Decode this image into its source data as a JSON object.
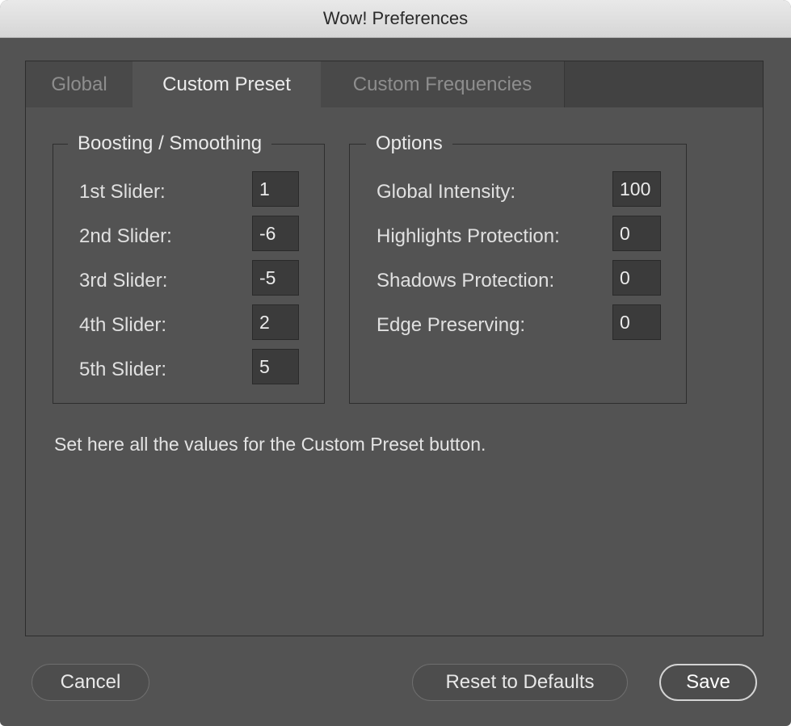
{
  "window": {
    "title": "Wow! Preferences"
  },
  "tabs": [
    {
      "label": "Global"
    },
    {
      "label": "Custom Preset"
    },
    {
      "label": "Custom Frequencies"
    }
  ],
  "active_tab": "Custom Preset",
  "boosting": {
    "legend": "Boosting / Smoothing",
    "rows": [
      {
        "label": "1st Slider:",
        "value": "1"
      },
      {
        "label": "2nd Slider:",
        "value": "-6"
      },
      {
        "label": "3rd Slider:",
        "value": "-5"
      },
      {
        "label": "4th Slider:",
        "value": "2"
      },
      {
        "label": "5th Slider:",
        "value": "5"
      }
    ]
  },
  "options": {
    "legend": "Options",
    "rows": [
      {
        "label": "Global Intensity:",
        "value": "100"
      },
      {
        "label": "Highlights Protection:",
        "value": "0"
      },
      {
        "label": "Shadows Protection:",
        "value": "0"
      },
      {
        "label": "Edge Preserving:",
        "value": "0"
      }
    ]
  },
  "description": "Set here all the values for the Custom Preset button.",
  "buttons": {
    "cancel": "Cancel",
    "reset": "Reset to Defaults",
    "save": "Save"
  },
  "colors": {
    "window_bg": "#535353",
    "tabbar_bg": "#424242",
    "field_bg": "#3b3b3b"
  }
}
